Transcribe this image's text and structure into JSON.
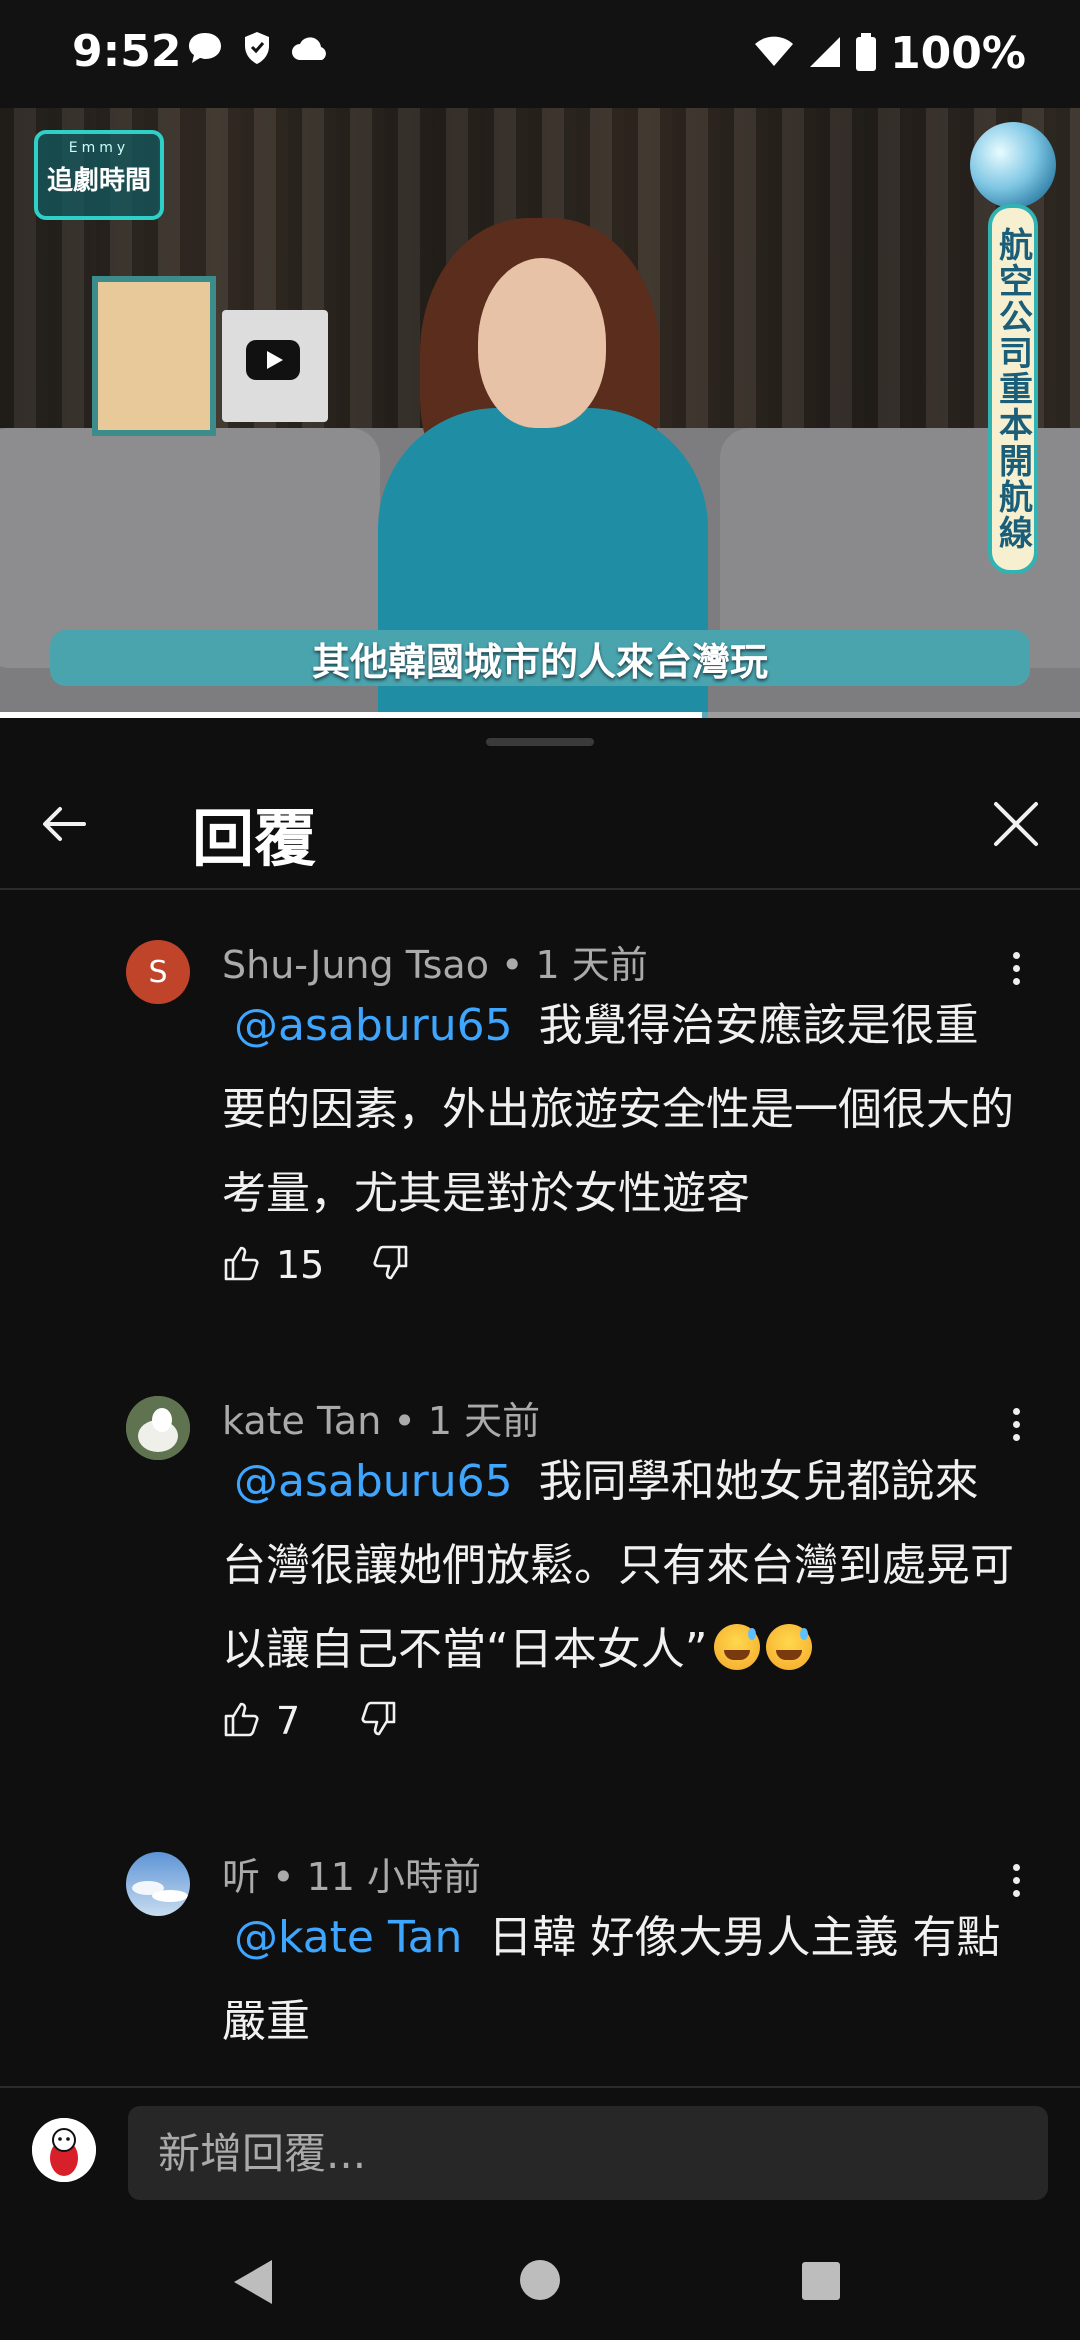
{
  "status_bar": {
    "time": "9:52",
    "left_icons": [
      "chat-bubble-icon",
      "shield-icon",
      "cloud-icon"
    ],
    "right_icons": [
      "wifi-icon",
      "signal-icon",
      "battery-icon"
    ],
    "battery": "100%"
  },
  "video": {
    "logo_small": "Emmy",
    "logo_big": "追劇時間",
    "vertical_banner": "航空公司重本開航線",
    "caption": "其他韓國城市的人來台灣玩",
    "progress": 0.65
  },
  "sheet": {
    "title": "回覆",
    "comments": [
      {
        "author": "Shu-Jung Tsao",
        "time": "1 天前",
        "avatar_letter": "S",
        "mention": "@asaburu65",
        "text": "我覺得治安應該是很重要的因素，外出旅遊安全性是一個很大的考量，尤其是對於女性遊客",
        "likes": "15"
      },
      {
        "author": "kate Tan",
        "time": "1 天前",
        "mention": "@asaburu65",
        "text": "我同學和她女兒都說來台灣很讓她們放鬆。只有來台灣到處晃可以讓自己不當“日本女人”",
        "emojis": [
          "grinning-sweat-emoji",
          "grinning-sweat-emoji"
        ],
        "likes": "7"
      },
      {
        "author": "听",
        "time": "11 小時前",
        "mention": "@kate Tan",
        "text": "日韓 好像大男人主義 有點嚴重"
      }
    ]
  },
  "reply": {
    "placeholder": "新增回覆..."
  },
  "colors": {
    "background": "#0f0f0f",
    "mention": "#3ea6ff",
    "meta": "#aaaaaa",
    "avatar_s": "#c0442a"
  }
}
